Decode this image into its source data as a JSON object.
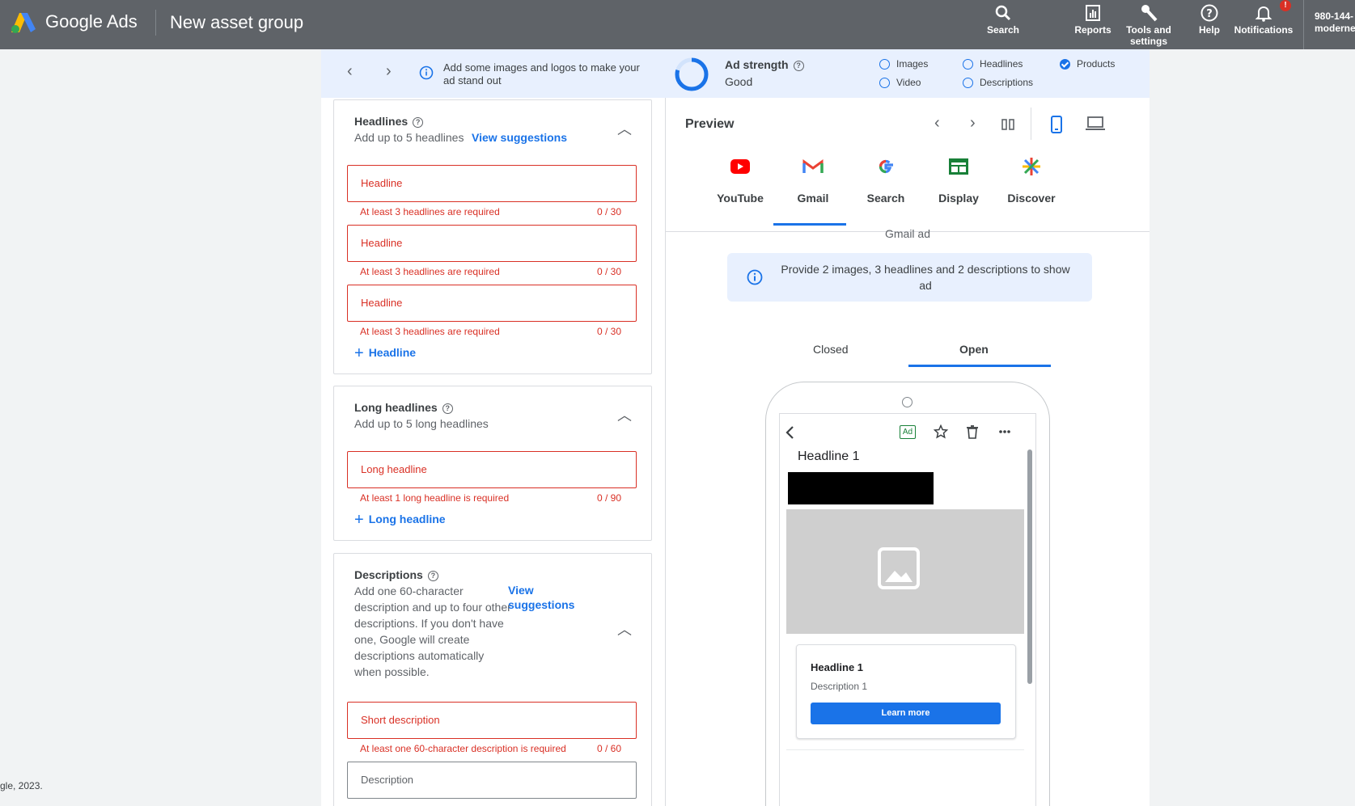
{
  "header": {
    "brand": "Google Ads",
    "page_title": "New asset group",
    "tools": [
      {
        "label": "Search",
        "icon": "search-icon"
      },
      {
        "label": "Reports",
        "icon": "reports-icon"
      },
      {
        "label": "Tools and settings",
        "icon": "wrench-icon"
      },
      {
        "label": "Help",
        "icon": "help-icon"
      },
      {
        "label": "Notifications",
        "icon": "bell-icon",
        "badge": "!"
      }
    ],
    "account_line1": "980-144-",
    "account_line2": "moderne"
  },
  "status_bar": {
    "message": "Add some images and logos to make your ad stand out",
    "strength_label": "Ad strength",
    "strength_value": "Good",
    "checklist": [
      {
        "label": "Images",
        "checked": false
      },
      {
        "label": "Video",
        "checked": false
      },
      {
        "label": "Headlines",
        "checked": false
      },
      {
        "label": "Descriptions",
        "checked": false
      },
      {
        "label": "Products",
        "checked": true
      }
    ]
  },
  "headlines": {
    "title": "Headlines",
    "subtitle": "Add up to 5 headlines",
    "view_suggestions": "View suggestions",
    "fields": [
      {
        "placeholder": "Headline",
        "error": "At least 3 headlines are required",
        "count": "0 / 30"
      },
      {
        "placeholder": "Headline",
        "error": "At least 3 headlines are required",
        "count": "0 / 30"
      },
      {
        "placeholder": "Headline",
        "error": "At least 3 headlines are required",
        "count": "0 / 30"
      }
    ],
    "add_label": "Headline"
  },
  "long_headlines": {
    "title": "Long headlines",
    "subtitle": "Add up to 5 long headlines",
    "fields": [
      {
        "placeholder": "Long headline",
        "error": "At least 1 long headline is required",
        "count": "0 / 90"
      }
    ],
    "add_label": "Long headline"
  },
  "descriptions": {
    "title": "Descriptions",
    "subtitle_lines": [
      "Add one 60-character",
      "description and up to four other",
      "descriptions. If you don't have",
      "one, Google will create",
      "descriptions automatically",
      "when possible."
    ],
    "view_line1": "View",
    "view_line2": "suggestions",
    "fields": [
      {
        "placeholder": "Short description",
        "error": "At least one 60-character description is required",
        "count": "0 / 60"
      },
      {
        "placeholder": "Description"
      }
    ]
  },
  "preview": {
    "title": "Preview",
    "tabs": [
      {
        "label": "YouTube",
        "icon": "youtube-icon"
      },
      {
        "label": "Gmail",
        "icon": "gmail-icon",
        "active": true
      },
      {
        "label": "Search",
        "icon": "google-icon"
      },
      {
        "label": "Display",
        "icon": "display-icon"
      },
      {
        "label": "Discover",
        "icon": "discover-icon"
      }
    ],
    "subtitle": "Gmail ad",
    "notice": "Provide 2 images, 3 headlines and 2 descriptions to show ad",
    "state_tabs": [
      "Closed",
      "Open"
    ],
    "active_state": "Open",
    "ad": {
      "badge": "Ad",
      "headline": "Headline 1",
      "card_headline": "Headline 1",
      "card_description": "Description 1",
      "cta": "Learn more"
    }
  },
  "footer": {
    "copyright": "gle, 2023."
  }
}
